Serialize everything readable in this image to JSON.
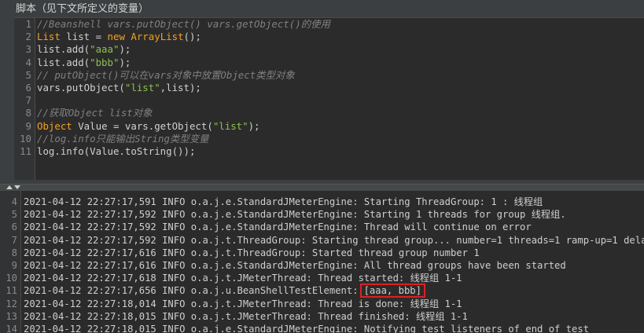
{
  "title": "脚本（见下文所定义的变量）",
  "editor": {
    "lines": [
      {
        "num": "1",
        "parts": [
          {
            "t": "//Beanshell vars.putObject() vars.getObject()的使用",
            "c": "cm"
          }
        ]
      },
      {
        "num": "2",
        "parts": [
          {
            "t": "List",
            "c": "ty"
          },
          {
            "t": " list = ",
            "c": ""
          },
          {
            "t": "new",
            "c": "kw"
          },
          {
            "t": " ",
            "c": ""
          },
          {
            "t": "ArrayList",
            "c": "ty"
          },
          {
            "t": "();",
            "c": ""
          }
        ]
      },
      {
        "num": "3",
        "parts": [
          {
            "t": "list.add(",
            "c": ""
          },
          {
            "t": "\"aaa\"",
            "c": "str"
          },
          {
            "t": ");",
            "c": ""
          }
        ]
      },
      {
        "num": "4",
        "parts": [
          {
            "t": "list.add(",
            "c": ""
          },
          {
            "t": "\"bbb\"",
            "c": "str"
          },
          {
            "t": ");",
            "c": ""
          }
        ]
      },
      {
        "num": "5",
        "parts": [
          {
            "t": "// putObject()可以在vars对象中放置Object类型对象",
            "c": "cm"
          }
        ]
      },
      {
        "num": "6",
        "parts": [
          {
            "t": "vars.putObject(",
            "c": ""
          },
          {
            "t": "\"list\"",
            "c": "str"
          },
          {
            "t": ",list);",
            "c": ""
          }
        ]
      },
      {
        "num": "7",
        "parts": []
      },
      {
        "num": "8",
        "parts": [
          {
            "t": "//获取Object list对象",
            "c": "cm"
          }
        ]
      },
      {
        "num": "9",
        "parts": [
          {
            "t": "Object",
            "c": "ty"
          },
          {
            "t": " Value = vars.getObject(",
            "c": ""
          },
          {
            "t": "\"list\"",
            "c": "str"
          },
          {
            "t": ");",
            "c": ""
          }
        ]
      },
      {
        "num": "10",
        "parts": [
          {
            "t": "//log.info只能输出String类型变量",
            "c": "cm"
          }
        ]
      },
      {
        "num": "11",
        "parts": [
          {
            "t": "log.info(Value.toString());",
            "c": ""
          }
        ]
      }
    ]
  },
  "log": {
    "lines": [
      {
        "num": "4",
        "text": "2021-04-12 22:27:17,591 INFO o.a.j.e.StandardJMeterEngine: Starting ThreadGroup: 1 : 线程组"
      },
      {
        "num": "5",
        "text": "2021-04-12 22:27:17,592 INFO o.a.j.e.StandardJMeterEngine: Starting 1 threads for group 线程组."
      },
      {
        "num": "6",
        "text": "2021-04-12 22:27:17,592 INFO o.a.j.e.StandardJMeterEngine: Thread will continue on error"
      },
      {
        "num": "7",
        "text": "2021-04-12 22:27:17,592 INFO o.a.j.t.ThreadGroup: Starting thread group... number=1 threads=1 ramp-up=1 delayedSt"
      },
      {
        "num": "8",
        "text": "2021-04-12 22:27:17,616 INFO o.a.j.t.ThreadGroup: Started thread group number 1"
      },
      {
        "num": "9",
        "text": "2021-04-12 22:27:17,616 INFO o.a.j.e.StandardJMeterEngine: All thread groups have been started"
      },
      {
        "num": "10",
        "text": "2021-04-12 22:27:17,618 INFO o.a.j.t.JMeterThread: Thread started: 线程组 1-1"
      },
      {
        "num": "11",
        "text": "2021-04-12 22:27:17,656 INFO o.a.j.u.BeanShellTestElement:",
        "highlight": "[aaa, bbb]"
      },
      {
        "num": "12",
        "text": "2021-04-12 22:27:18,014 INFO o.a.j.t.JMeterThread: Thread is done: 线程组 1-1"
      },
      {
        "num": "13",
        "text": "2021-04-12 22:27:18,015 INFO o.a.j.t.JMeterThread: Thread finished: 线程组 1-1"
      },
      {
        "num": "14",
        "text": "2021-04-12 22:27:18,015 INFO o.a.j.e.StandardJMeterEngine: Notifying test listeners of end of test"
      }
    ]
  },
  "colors": {
    "highlight_border": "#e02020",
    "comment": "#808080",
    "keyword": "#f5a11d",
    "string": "#8fbf54"
  }
}
